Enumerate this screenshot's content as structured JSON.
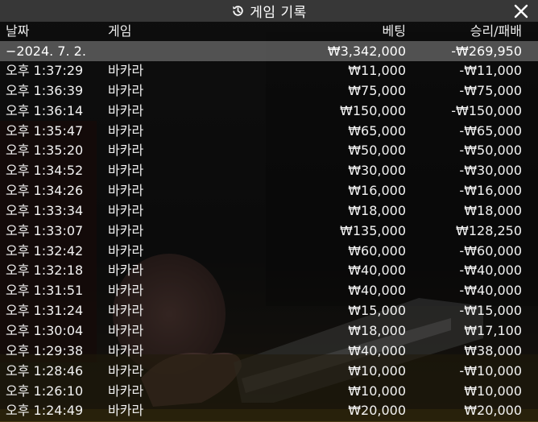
{
  "window": {
    "title": "게임 기록",
    "title_icon": "history-icon",
    "close_icon": "close-icon"
  },
  "columns": {
    "date": "날짜",
    "game": "게임",
    "bet": "베팅",
    "win_loss": "승리/패배"
  },
  "date_group": {
    "label": "−2024. 7. 2.",
    "total_bet": "₩3,342,000",
    "total_win_loss": "-₩269,950"
  },
  "rows": [
    {
      "time": "오후 1:37:29",
      "game": "바카라",
      "bet": "₩11,000",
      "result": "-₩11,000"
    },
    {
      "time": "오후 1:36:39",
      "game": "바카라",
      "bet": "₩75,000",
      "result": "-₩75,000"
    },
    {
      "time": "오후 1:36:14",
      "game": "바카라",
      "bet": "₩150,000",
      "result": "-₩150,000"
    },
    {
      "time": "오후 1:35:47",
      "game": "바카라",
      "bet": "₩65,000",
      "result": "-₩65,000"
    },
    {
      "time": "오후 1:35:20",
      "game": "바카라",
      "bet": "₩50,000",
      "result": "-₩50,000"
    },
    {
      "time": "오후 1:34:52",
      "game": "바카라",
      "bet": "₩30,000",
      "result": "-₩30,000"
    },
    {
      "time": "오후 1:34:26",
      "game": "바카라",
      "bet": "₩16,000",
      "result": "-₩16,000"
    },
    {
      "time": "오후 1:33:34",
      "game": "바카라",
      "bet": "₩18,000",
      "result": "₩18,000"
    },
    {
      "time": "오후 1:33:07",
      "game": "바카라",
      "bet": "₩135,000",
      "result": "₩128,250"
    },
    {
      "time": "오후 1:32:42",
      "game": "바카라",
      "bet": "₩60,000",
      "result": "-₩60,000"
    },
    {
      "time": "오후 1:32:18",
      "game": "바카라",
      "bet": "₩40,000",
      "result": "-₩40,000"
    },
    {
      "time": "오후 1:31:51",
      "game": "바카라",
      "bet": "₩40,000",
      "result": "-₩40,000"
    },
    {
      "time": "오후 1:31:24",
      "game": "바카라",
      "bet": "₩15,000",
      "result": "-₩15,000"
    },
    {
      "time": "오후 1:30:04",
      "game": "바카라",
      "bet": "₩18,000",
      "result": "₩17,100"
    },
    {
      "time": "오후 1:29:38",
      "game": "바카라",
      "bet": "₩40,000",
      "result": "₩38,000"
    },
    {
      "time": "오후 1:28:46",
      "game": "바카라",
      "bet": "₩10,000",
      "result": "-₩10,000"
    },
    {
      "time": "오후 1:26:10",
      "game": "바카라",
      "bet": "₩10,000",
      "result": "₩10,000"
    },
    {
      "time": "오후 1:24:49",
      "game": "바카라",
      "bet": "₩20,000",
      "result": "₩20,000"
    }
  ]
}
